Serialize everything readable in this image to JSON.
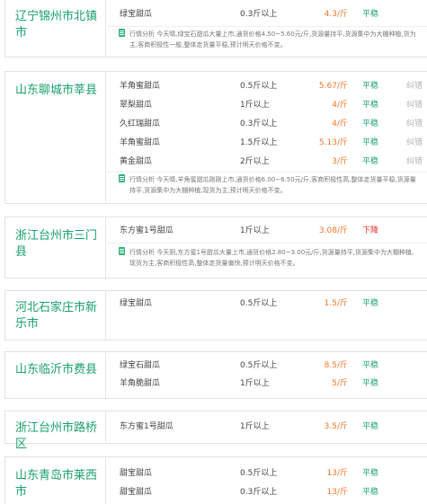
{
  "colors": {
    "region": "#1aa06b",
    "price": "#f07828",
    "stable": "#1aa06b",
    "down": "#e0302a",
    "action": "#b5b5b5"
  },
  "markets": [
    {
      "region": "辽宁锦州市北镇市",
      "rows": [
        {
          "name": "绿宝甜瓜",
          "spec": "0.3斤以上",
          "price": "4.3/斤",
          "trend": "平稳",
          "action": ""
        }
      ],
      "analysis": "行情分析  今天晴,绿宝石甜瓜大量上市,通货价格4.50~5.60元/斤,货源量持平,货源集中为大棚种植,货为主,客商积极性一般,整体走货量平稳,预计明天价格不变。"
    },
    {
      "region": "山东聊城市莘县",
      "rows": [
        {
          "name": "羊角蜜甜瓜",
          "spec": "0.5斤以上",
          "price": "5.67/斤",
          "trend": "平稳",
          "action": "纠错"
        },
        {
          "name": "翠梨甜瓜",
          "spec": "1斤以上",
          "price": "4/斤",
          "trend": "平稳",
          "action": "纠错"
        },
        {
          "name": "久红瑞甜瓜",
          "spec": "0.3斤以上",
          "price": "4/斤",
          "trend": "平稳",
          "action": "纠错"
        },
        {
          "name": "羊角蜜甜瓜",
          "spec": "1.5斤以上",
          "price": "5.13/斤",
          "trend": "平稳",
          "action": "纠错"
        },
        {
          "name": "黄金甜瓜",
          "spec": "2斤以上",
          "price": "3/斤",
          "trend": "平稳",
          "action": "纠错"
        }
      ],
      "analysis": "行情分析  今天晴,羊角蜜甜瓜刚刚上市,通货价格6.00~6.50元/斤,客商积极性高,整体走货量平稳,货源量持平,货源集中为大棚种植,现货为主,预计明天价格不变。"
    },
    {
      "region": "浙江台州市三门县",
      "rows": [
        {
          "name": "东方蜜1号甜瓜",
          "spec": "1斤以上",
          "price": "3.08/斤",
          "trend": "下降",
          "action": ""
        }
      ],
      "analysis": "行情分析  今天阴,东方蜜1号甜瓜大量上市,通货价格2.80~3.00元/斤,货源量持平,货源集中为大棚种植,现货为主,客商积极性高,整体走货量偏快,预计明天价格不变。"
    },
    {
      "region": "河北石家庄市新乐市",
      "rows": [
        {
          "name": "绿宝甜瓜",
          "spec": "0.5斤以上",
          "price": "1.5/斤",
          "trend": "平稳",
          "action": ""
        }
      ],
      "analysis": ""
    },
    {
      "region": "山东临沂市费县",
      "rows": [
        {
          "name": "绿宝石甜瓜",
          "spec": "0.5斤以上",
          "price": "8.5/斤",
          "trend": "平稳",
          "action": ""
        },
        {
          "name": "羊角脆甜瓜",
          "spec": "1斤以上",
          "price": "5/斤",
          "trend": "平稳",
          "action": ""
        }
      ],
      "analysis": ""
    },
    {
      "region": "浙江台州市路桥区",
      "rows": [
        {
          "name": "东方蜜1号甜瓜",
          "spec": "1斤以上",
          "price": "3.5/斤",
          "trend": "平稳",
          "action": ""
        }
      ],
      "analysis": ""
    },
    {
      "region": "山东青岛市莱西市",
      "rows": [
        {
          "name": "甜宝甜瓜",
          "spec": "0.5斤以上",
          "price": "13/斤",
          "trend": "平稳",
          "action": ""
        },
        {
          "name": "甜宝甜瓜",
          "spec": "0.3斤以上",
          "price": "13/斤",
          "trend": "平稳",
          "action": ""
        }
      ],
      "analysis": ""
    }
  ]
}
